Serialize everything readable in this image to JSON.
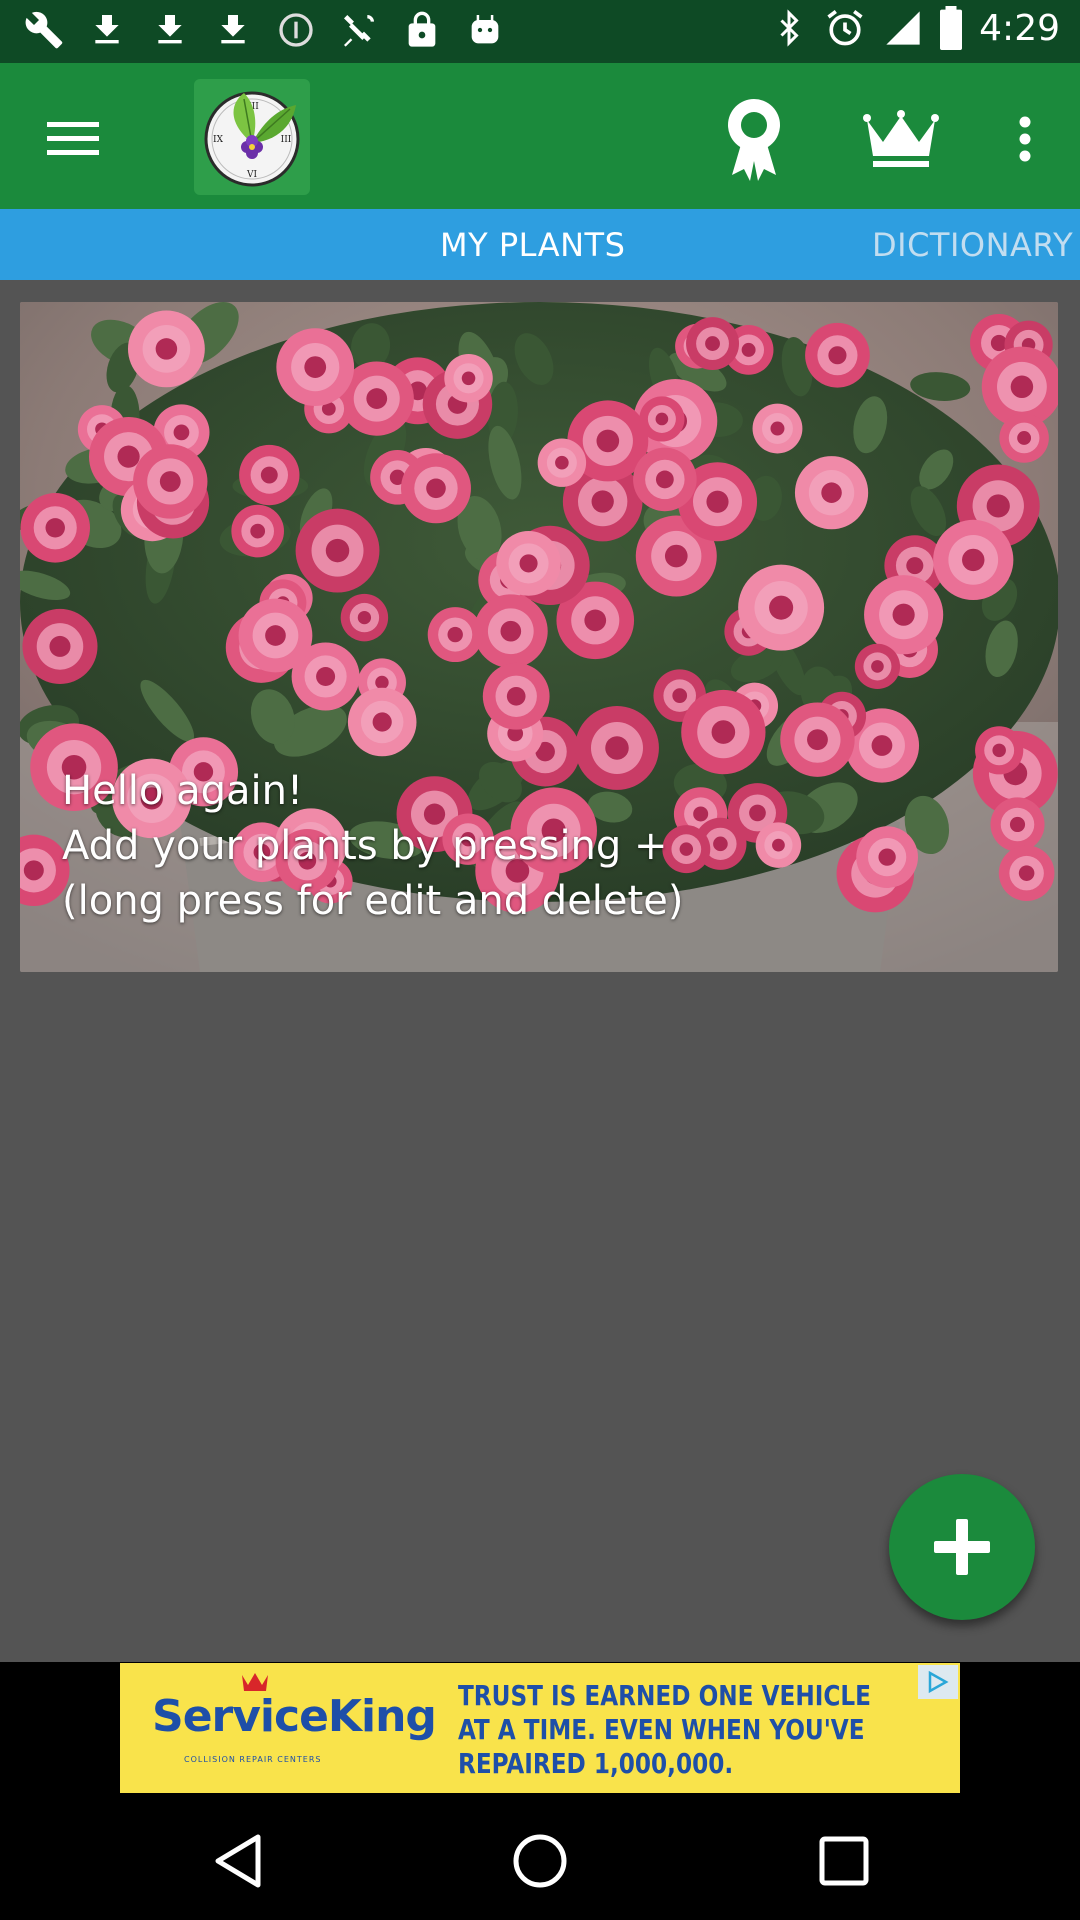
{
  "status_bar": {
    "time": "4:29",
    "left_icons": [
      "wrench-icon",
      "download-icon",
      "download-icon",
      "download-icon",
      "info-icon",
      "satellite-icon",
      "lock-icon",
      "android-icon"
    ],
    "right_icons": [
      "bluetooth-icon",
      "alarm-icon",
      "signal-icon",
      "battery-icon"
    ]
  },
  "toolbar": {
    "icons": [
      "menu-icon",
      "app-logo",
      "award-icon",
      "crown-icon",
      "more-icon"
    ]
  },
  "tabs": [
    {
      "label": "MY PLANTS",
      "active": true
    },
    {
      "label": "DICTIONARY",
      "active": false
    }
  ],
  "card": {
    "line1": "Hello again!",
    "line2": "Add your plants by pressing +",
    "line3": "(long press for edit and delete)"
  },
  "fab": {
    "icon": "plus-icon"
  },
  "ad": {
    "brand": "ServiceKing",
    "brand_sub": "COLLISION REPAIR CENTERS",
    "line1": "TRUST IS EARNED ONE VEHICLE",
    "line2": "AT A TIME. EVEN WHEN YOU'VE",
    "line3": "REPAIRED 1,000,000."
  },
  "colors": {
    "status_bar": "#0e4a25",
    "toolbar": "#1b8a3c",
    "tabs": "#2e9ee0",
    "background": "#545454",
    "ad_background": "#f9e34b",
    "ad_text": "#1e4fa8"
  }
}
